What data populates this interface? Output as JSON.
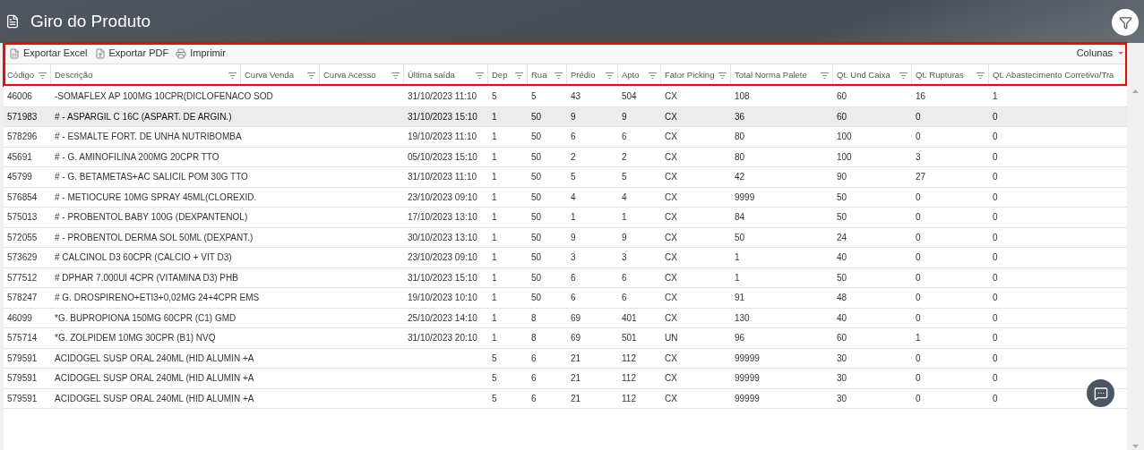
{
  "page": {
    "title": "Giro do Produto"
  },
  "toolbar": {
    "highlighted": true,
    "actions": [
      "Exportar Excel",
      "Exportar PDF",
      "Imprimir"
    ],
    "columns_menu": "Colunas"
  },
  "table": {
    "columns": [
      "Código",
      "Descrição",
      "Curva Venda",
      "Curva Acesso",
      "Última saída",
      "Dep",
      "Rua",
      "Prédio",
      "Apto",
      "Fator Picking",
      "Total Norma Palete",
      "Qt. Und Caixa",
      "Qt. Rupturas",
      "Qt. Abastecimento Corretivo/Tra"
    ],
    "rows": [
      {
        "selected": false,
        "codigo": "46006",
        "descricao": "-SOMAFLEX AP 100MG 10CPR(DICLOFENACO SOD",
        "ultima_saida": "31/10/2023 11:10",
        "dep": "5",
        "rua": "5",
        "predio": "43",
        "apto": "504",
        "fator_picking": "CX",
        "total_norma_palete": "108",
        "qt_und_caixa": "60",
        "qt_rupturas": "16",
        "qt_abastecimento": "1"
      },
      {
        "selected": true,
        "codigo": "571983",
        "descricao": "# - ASPARGIL C 16C (ASPART. DE ARGIN.)",
        "ultima_saida": "31/10/2023 15:10",
        "dep": "1",
        "rua": "50",
        "predio": "9",
        "apto": "9",
        "fator_picking": "CX",
        "total_norma_palete": "36",
        "qt_und_caixa": "60",
        "qt_rupturas": "0",
        "qt_abastecimento": "0"
      },
      {
        "selected": false,
        "codigo": "578296",
        "descricao": "# - ESMALTE FORT. DE UNHA NUTRIBOMBA",
        "ultima_saida": "19/10/2023 11:10",
        "dep": "1",
        "rua": "50",
        "predio": "6",
        "apto": "6",
        "fator_picking": "CX",
        "total_norma_palete": "80",
        "qt_und_caixa": "100",
        "qt_rupturas": "0",
        "qt_abastecimento": "0"
      },
      {
        "selected": false,
        "codigo": "45691",
        "descricao": "# - G. AMINOFILINA 200MG 20CPR TTO",
        "ultima_saida": "05/10/2023 15:10",
        "dep": "1",
        "rua": "50",
        "predio": "2",
        "apto": "2",
        "fator_picking": "CX",
        "total_norma_palete": "80",
        "qt_und_caixa": "100",
        "qt_rupturas": "3",
        "qt_abastecimento": "0"
      },
      {
        "selected": false,
        "codigo": "45799",
        "descricao": "# - G. BETAMETAS+AC SALICIL POM 30G TTO",
        "ultima_saida": "31/10/2023 11:10",
        "dep": "1",
        "rua": "50",
        "predio": "5",
        "apto": "5",
        "fator_picking": "CX",
        "total_norma_palete": "42",
        "qt_und_caixa": "90",
        "qt_rupturas": "27",
        "qt_abastecimento": "0"
      },
      {
        "selected": false,
        "codigo": "576854",
        "descricao": "# - METIOCURE 10MG SPRAY 45ML(CLOREXID.",
        "ultima_saida": "23/10/2023 09:10",
        "dep": "1",
        "rua": "50",
        "predio": "4",
        "apto": "4",
        "fator_picking": "CX",
        "total_norma_palete": "9999",
        "qt_und_caixa": "50",
        "qt_rupturas": "0",
        "qt_abastecimento": "0"
      },
      {
        "selected": false,
        "codigo": "575013",
        "descricao": "# - PROBENTOL BABY 100G (DEXPANTENOL)",
        "ultima_saida": "17/10/2023 13:10",
        "dep": "1",
        "rua": "50",
        "predio": "1",
        "apto": "1",
        "fator_picking": "CX",
        "total_norma_palete": "84",
        "qt_und_caixa": "50",
        "qt_rupturas": "0",
        "qt_abastecimento": "0"
      },
      {
        "selected": false,
        "codigo": "572055",
        "descricao": "# - PROBENTOL DERMA SOL 50ML (DEXPANT.)",
        "ultima_saida": "30/10/2023 13:10",
        "dep": "1",
        "rua": "50",
        "predio": "9",
        "apto": "9",
        "fator_picking": "CX",
        "total_norma_palete": "50",
        "qt_und_caixa": "24",
        "qt_rupturas": "0",
        "qt_abastecimento": "0"
      },
      {
        "selected": false,
        "codigo": "573629",
        "descricao": "# CALCINOL D3 60CPR (CALCIO + VIT D3)",
        "ultima_saida": "23/10/2023 09:10",
        "dep": "1",
        "rua": "50",
        "predio": "3",
        "apto": "3",
        "fator_picking": "CX",
        "total_norma_palete": "1",
        "qt_und_caixa": "40",
        "qt_rupturas": "0",
        "qt_abastecimento": "0"
      },
      {
        "selected": false,
        "codigo": "577512",
        "descricao": "# DPHAR 7.000UI 4CPR (VITAMINA D3) PHB",
        "ultima_saida": "31/10/2023 15:10",
        "dep": "1",
        "rua": "50",
        "predio": "6",
        "apto": "6",
        "fator_picking": "CX",
        "total_norma_palete": "1",
        "qt_und_caixa": "50",
        "qt_rupturas": "0",
        "qt_abastecimento": "0"
      },
      {
        "selected": false,
        "codigo": "578247",
        "descricao": "# G. DROSPIRENO+ETI3+0,02MG 24+4CPR EMS",
        "ultima_saida": "19/10/2023 10:10",
        "dep": "1",
        "rua": "50",
        "predio": "6",
        "apto": "6",
        "fator_picking": "CX",
        "total_norma_palete": "91",
        "qt_und_caixa": "48",
        "qt_rupturas": "0",
        "qt_abastecimento": "0"
      },
      {
        "selected": false,
        "codigo": "46099",
        "descricao": "*G. BUPROPIONA 150MG 60CPR (C1) GMD",
        "ultima_saida": "25/10/2023 14:10",
        "dep": "1",
        "rua": "8",
        "predio": "69",
        "apto": "401",
        "fator_picking": "CX",
        "total_norma_palete": "130",
        "qt_und_caixa": "40",
        "qt_rupturas": "0",
        "qt_abastecimento": "0"
      },
      {
        "selected": false,
        "codigo": "575714",
        "descricao": "*G. ZOLPIDEM 10MG 30CPR (B1) NVQ",
        "ultima_saida": "31/10/2023 20:10",
        "dep": "1",
        "rua": "8",
        "predio": "69",
        "apto": "501",
        "fator_picking": "UN",
        "total_norma_palete": "96",
        "qt_und_caixa": "60",
        "qt_rupturas": "1",
        "qt_abastecimento": "0"
      },
      {
        "selected": false,
        "codigo": "579591",
        "descricao": "ACIDOGEL SUSP ORAL 240ML (HID ALUMIN +A",
        "dep": "5",
        "rua": "6",
        "predio": "21",
        "apto": "112",
        "fator_picking": "CX",
        "total_norma_palete": "99999",
        "qt_und_caixa": "30",
        "qt_rupturas": "0",
        "qt_abastecimento": "0"
      },
      {
        "selected": false,
        "codigo": "579591",
        "descricao": "ACIDOGEL SUSP ORAL 240ML (HID ALUMIN +A",
        "dep": "5",
        "rua": "6",
        "predio": "21",
        "apto": "112",
        "fator_picking": "CX",
        "total_norma_palete": "99999",
        "qt_und_caixa": "30",
        "qt_rupturas": "0",
        "qt_abastecimento": "0"
      },
      {
        "selected": false,
        "codigo": "579591",
        "descricao": "ACIDOGEL SUSP ORAL 240ML (HID ALUMIN +A",
        "dep": "5",
        "rua": "6",
        "predio": "21",
        "apto": "112",
        "fator_picking": "CX",
        "total_norma_palete": "99999",
        "qt_und_caixa": "30",
        "qt_rupturas": "0",
        "qt_abastecimento": "0"
      }
    ]
  }
}
